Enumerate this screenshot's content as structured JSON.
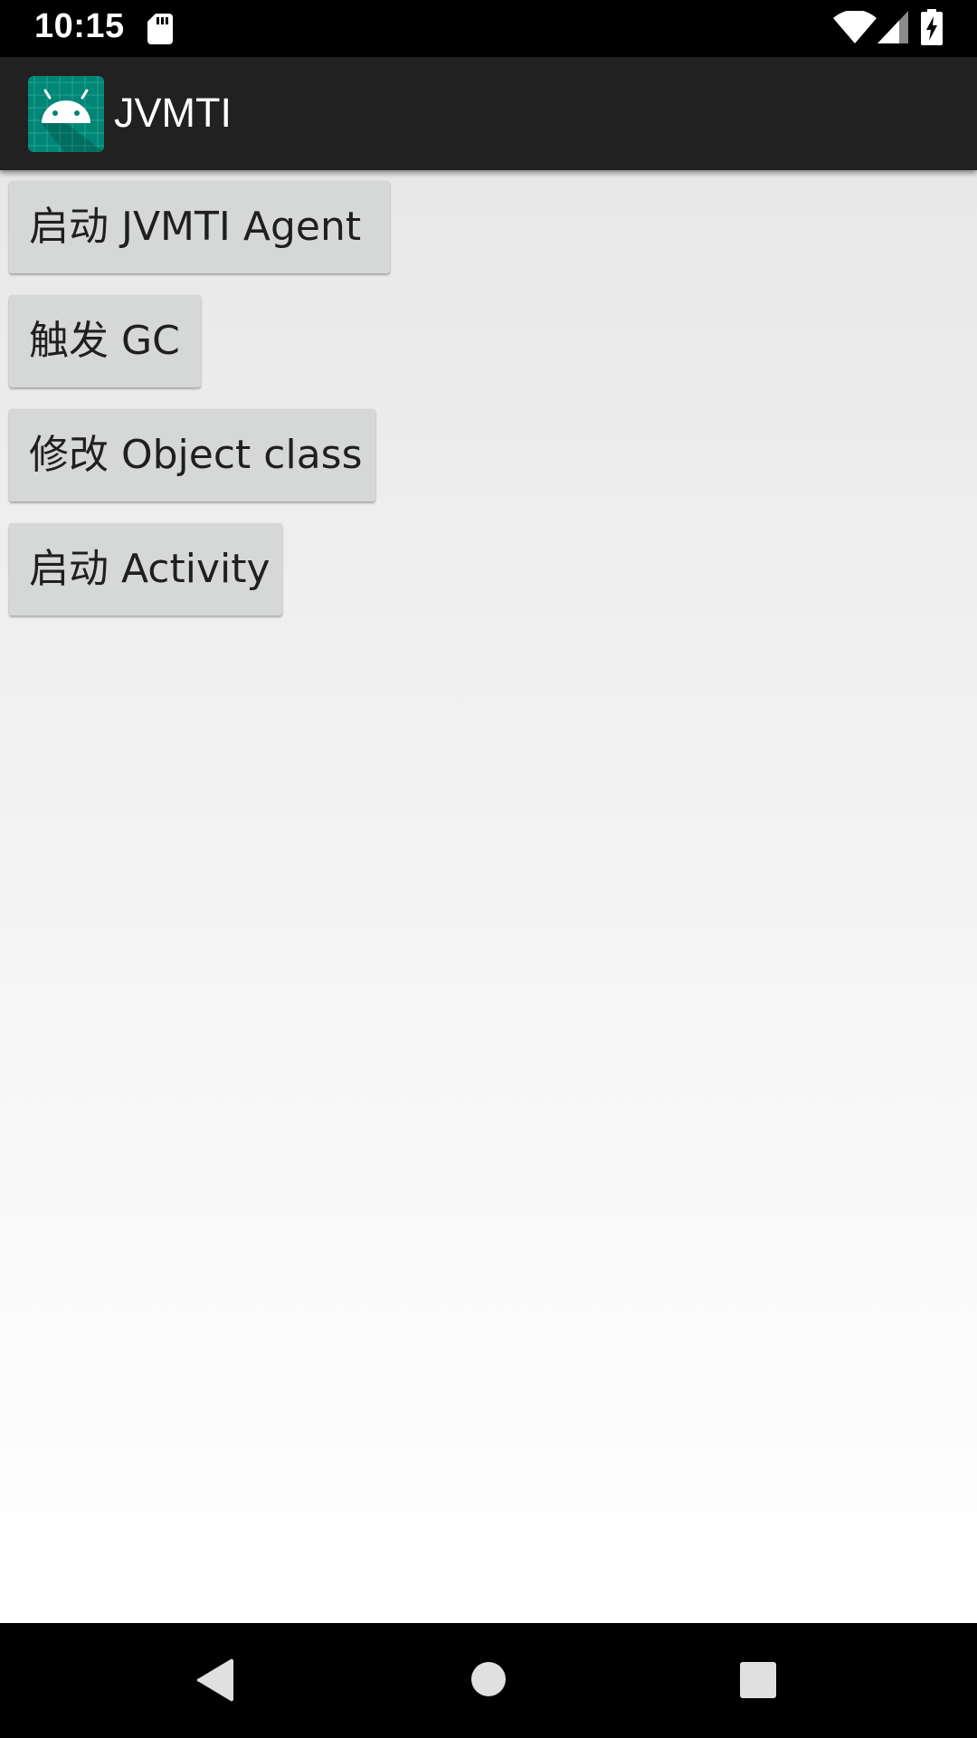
{
  "status_bar": {
    "time": "10:15",
    "icons": [
      "sd-card-icon",
      "wifi-icon",
      "signal-icon",
      "battery-charging-icon"
    ]
  },
  "app_bar": {
    "title": "JVMTI",
    "icon": "android-launcher-icon",
    "background_color": "#212121",
    "icon_color": "#008577"
  },
  "buttons": [
    {
      "label": "启动 JVMTI Agent"
    },
    {
      "label": "触发 GC"
    },
    {
      "label": "修改 Object class"
    },
    {
      "label": "启动 Activity"
    }
  ],
  "nav_bar": {
    "items": [
      "back-icon",
      "home-icon",
      "recents-icon"
    ]
  }
}
